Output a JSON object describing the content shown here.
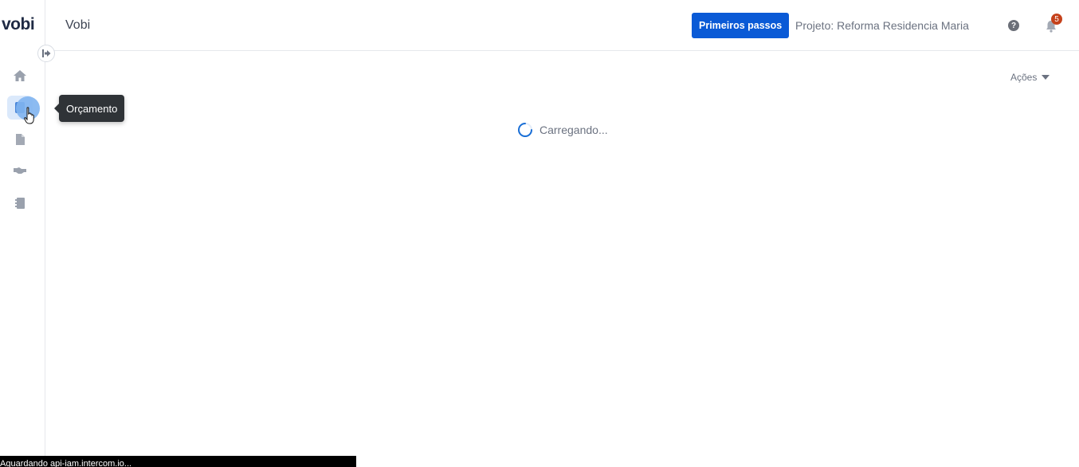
{
  "sidebar": {
    "logo": "vobi",
    "items": [
      {
        "name": "home-icon"
      },
      {
        "name": "budget-icon",
        "active": true
      },
      {
        "name": "document-icon"
      },
      {
        "name": "handshake-icon"
      },
      {
        "name": "notebook-icon"
      }
    ],
    "tooltip": "Orçamento"
  },
  "header": {
    "title": "Vobi",
    "primary_button": "Primeiros passos",
    "project": "Projeto: Reforma Residencia Maria",
    "help_icon": "?",
    "notification_count": "5"
  },
  "main": {
    "actions_label": "Ações",
    "loading_text": "Carregando..."
  },
  "status_bar": "Aguardando api-iam.intercom.io...",
  "colors": {
    "primary": "#0a5ad6",
    "badge": "#c5411b",
    "tooltip_bg": "#2f3337",
    "active_nav_bg": "#dbe9fb"
  }
}
